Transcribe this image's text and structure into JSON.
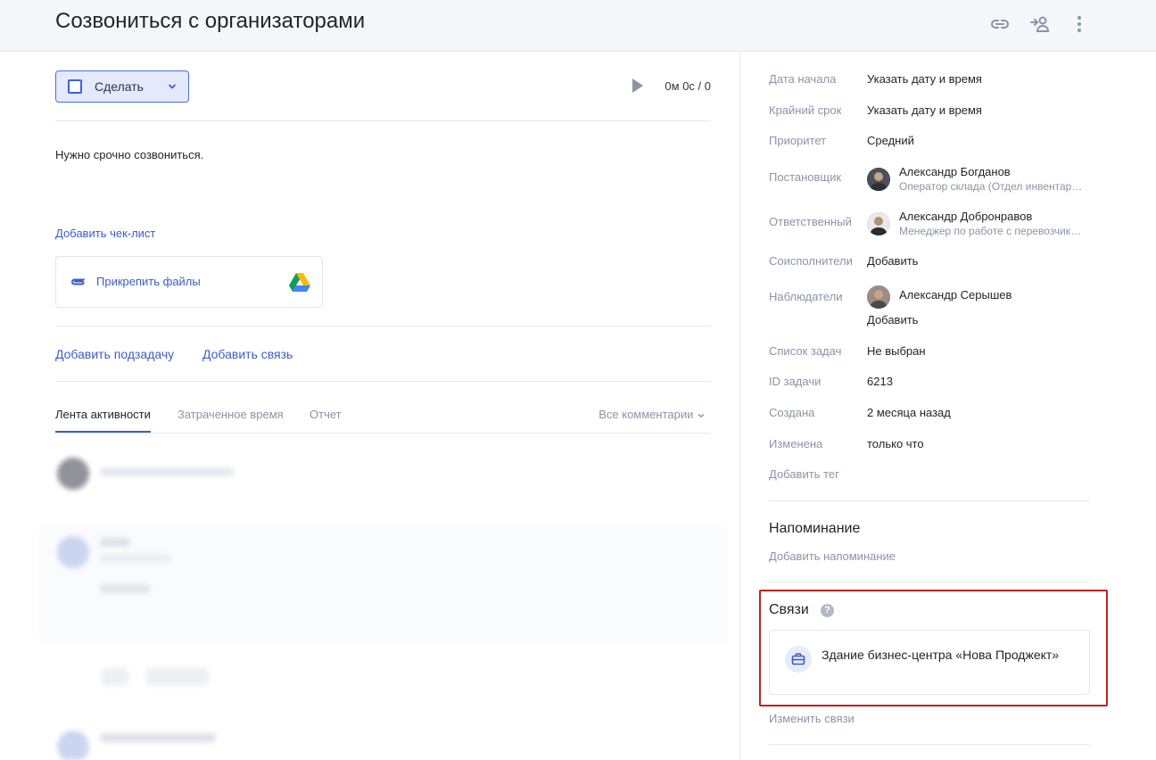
{
  "header": {
    "title": "Созвониться с организаторами"
  },
  "task": {
    "status_label": "Сделать",
    "timer": "0м 0с / 0",
    "description": "Нужно срочно созвониться.",
    "add_checklist": "Добавить чек-лист",
    "attach_files": "Прикрепить файлы",
    "add_subtask": "Добавить подзадачу",
    "add_relation": "Добавить связь"
  },
  "activity": {
    "tabs": [
      "Лента активности",
      "Затраченное время",
      "Отчет"
    ],
    "filter": "Все комментарии"
  },
  "properties": {
    "start_date": {
      "label": "Дата начала",
      "value": "Указать дату и время"
    },
    "deadline": {
      "label": "Крайний срок",
      "value": "Указать дату и время"
    },
    "priority": {
      "label": "Приоритет",
      "value": "Средний"
    },
    "creator": {
      "label": "Постановщик",
      "name": "Александр Богданов",
      "role": "Оператор склада (Отдел инвентаризации)"
    },
    "assignee": {
      "label": "Ответственный",
      "name": "Александр Добронравов",
      "role": "Менеджер по работе с перевозчиками"
    },
    "coexecutors": {
      "label": "Соисполнители",
      "action": "Добавить"
    },
    "observers": {
      "label": "Наблюдатели",
      "name": "Александр Серышев",
      "action": "Добавить"
    },
    "task_list": {
      "label": "Список задач",
      "value": "Не выбран"
    },
    "task_id": {
      "label": "ID задачи",
      "value": "6213"
    },
    "created": {
      "label": "Создана",
      "value": "2 месяца назад"
    },
    "modified": {
      "label": "Изменена",
      "value": "только что"
    },
    "add_tag": "Добавить тег"
  },
  "reminder": {
    "title": "Напоминание",
    "action": "Добавить напоминание"
  },
  "relations": {
    "title": "Связи",
    "help": "?",
    "item": "Здание бизнес-центра «Нова Проджект»",
    "action": "Изменить связи"
  },
  "colors": {
    "accent": "#3b5ccc",
    "highlight": "#c0221b",
    "muted": "#8a94a6"
  }
}
